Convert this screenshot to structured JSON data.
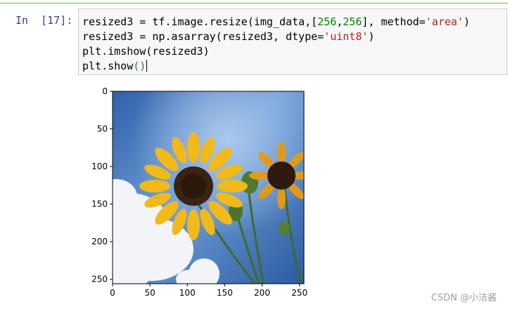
{
  "cell": {
    "prompt": "In  [17]:",
    "lines": [
      [
        {
          "t": "resized3 = tf.image.resize(img_data,[",
          "c": ""
        },
        {
          "t": "256",
          "c": "num"
        },
        {
          "t": ",",
          "c": ""
        },
        {
          "t": "256",
          "c": "num"
        },
        {
          "t": "], method=",
          "c": ""
        },
        {
          "t": "'area'",
          "c": "str"
        },
        {
          "t": ")",
          "c": ""
        }
      ],
      [
        {
          "t": "resized3 = np.asarray(resized3, dtype=",
          "c": ""
        },
        {
          "t": "'uint8'",
          "c": "str"
        },
        {
          "t": ")",
          "c": ""
        }
      ],
      [
        {
          "t": "plt.imshow(resized3)",
          "c": ""
        }
      ],
      [
        {
          "t": "plt.show",
          "c": ""
        },
        {
          "t": "()",
          "c": "paren-hl"
        }
      ]
    ]
  },
  "plot": {
    "x_ticks": [
      "0",
      "50",
      "100",
      "150",
      "200",
      "250"
    ],
    "y_ticks": [
      "0",
      "50",
      "100",
      "150",
      "200",
      "250"
    ],
    "image_description_icon": "sunflower-image"
  },
  "watermark": "CSDN @小洁酱"
}
